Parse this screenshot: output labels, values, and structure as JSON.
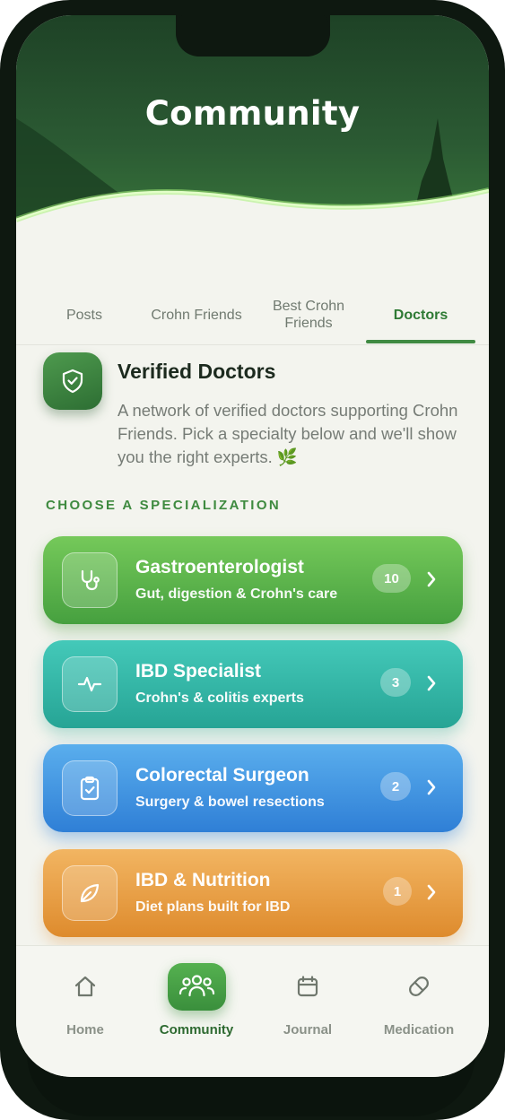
{
  "header": {
    "title": "Community"
  },
  "tabs": [
    {
      "label": "Posts",
      "active": false
    },
    {
      "label": "Crohn Friends",
      "active": false
    },
    {
      "label": "Best Crohn Friends",
      "active": false
    },
    {
      "label": "Doctors",
      "active": true
    }
  ],
  "intro": {
    "icon": "shield-check-icon",
    "title": "Verified Doctors",
    "text": "A network of verified doctors supporting Crohn Friends. Pick a specialty below and we'll show you the right experts. 🌿"
  },
  "section_label": "CHOOSE A SPECIALIZATION",
  "specializations": [
    {
      "icon": "stethoscope-icon",
      "title": "Gastroenterologist",
      "subtitle": "Gut, digestion & Crohn's care",
      "count": "10",
      "color": "#5bb24a"
    },
    {
      "icon": "pulse-icon",
      "title": "IBD Specialist",
      "subtitle": "Crohn's & colitis experts",
      "count": "3",
      "color": "#33b7a6"
    },
    {
      "icon": "clipboard-check-icon",
      "title": "Colorectal Surgeon",
      "subtitle": "Surgery & bowel resections",
      "count": "2",
      "color": "#4596e2"
    },
    {
      "icon": "leaf-icon",
      "title": "IBD & Nutrition",
      "subtitle": "Diet plans built for IBD",
      "count": "1",
      "color": "#e99f46"
    }
  ],
  "bottom_nav": [
    {
      "icon": "home-icon",
      "label": "Home",
      "active": false
    },
    {
      "icon": "users-icon",
      "label": "Community",
      "active": true
    },
    {
      "icon": "calendar-icon",
      "label": "Journal",
      "active": false
    },
    {
      "icon": "pill-icon",
      "label": "Medication",
      "active": false
    }
  ],
  "colors": {
    "brand": "#2e7a34",
    "header": "#2b5a33",
    "background": "#f3f4ee"
  }
}
